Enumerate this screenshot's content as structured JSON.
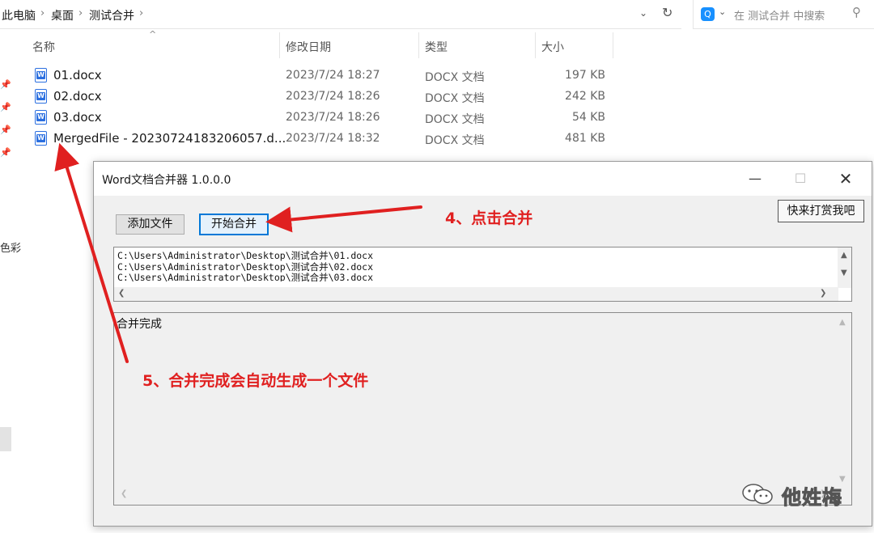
{
  "explorer": {
    "breadcrumbs": [
      "此电脑",
      "桌面",
      "测试合并"
    ],
    "breadcrumb_sep": "›",
    "search_placeholder": "在 测试合并 中搜索",
    "columns": {
      "name": "名称",
      "date": "修改日期",
      "type": "类型",
      "size": "大小"
    },
    "files": [
      {
        "name": "01.docx",
        "date": "2023/7/24 18:27",
        "type": "DOCX 文档",
        "size": "197 KB"
      },
      {
        "name": "02.docx",
        "date": "2023/7/24 18:26",
        "type": "DOCX 文档",
        "size": "242 KB"
      },
      {
        "name": "03.docx",
        "date": "2023/7/24 18:26",
        "type": "DOCX 文档",
        "size": "54 KB"
      },
      {
        "name": "MergedFile - 20230724183206057.d...",
        "date": "2023/7/24 18:32",
        "type": "DOCX 文档",
        "size": "481 KB"
      }
    ],
    "left_nav_partial_text": "色彩"
  },
  "app_window": {
    "title": "Word文档合并器 1.0.0.0",
    "add_file_label": "添加文件",
    "start_merge_label": "开始合并",
    "tip_button_label": "快来打赏我吧",
    "file_list": [
      "C:\\Users\\Administrator\\Desktop\\测试合并\\01.docx",
      "C:\\Users\\Administrator\\Desktop\\测试合并\\02.docx",
      "C:\\Users\\Administrator\\Desktop\\测试合并\\03.docx"
    ],
    "log_text": "合并完成"
  },
  "annotations": {
    "step4": "4、点击合并",
    "step5": "5、合并完成会自动生成一个文件",
    "color": "#e02020"
  },
  "watermark": {
    "text": "他姓梅"
  },
  "colors": {
    "accent": "#0078d7",
    "word_icon": "#2b6fe0",
    "search_badge": "#1890ff"
  }
}
